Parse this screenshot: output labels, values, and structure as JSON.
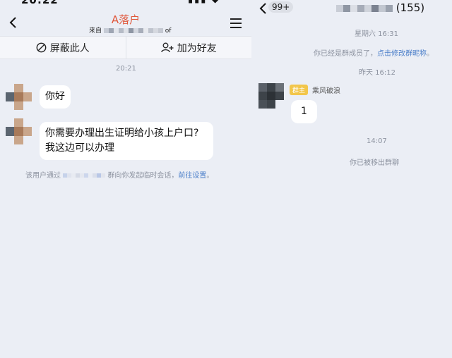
{
  "left_chat": {
    "title": "A落户",
    "subtitle_prefix": "来自",
    "subtitle_suffix": "of",
    "actions": {
      "block_label": "屏蔽此人",
      "add_friend_label": "加为好友"
    },
    "timestamp": "20:21",
    "messages": [
      {
        "text": "你好"
      },
      {
        "line1": "你需要办理出生证明给小孩上户口?",
        "line2": "我这边可以办理"
      }
    ],
    "notice": {
      "prefix": "该用户通过",
      "middle": "群向你发起临时会话，",
      "link": "前往设置",
      "suffix": "。"
    }
  },
  "right_chat": {
    "unread_badge": "99+",
    "member_count": "(155)",
    "timestamp_1": "星期六 16:31",
    "system_1": {
      "text": "你已经是群成员了，",
      "link": "点击修改群昵称",
      "suffix": "。"
    },
    "timestamp_2": "昨天 16:12",
    "owner_tag": "群主",
    "sender_name": "乘风破浪",
    "message": "1",
    "timestamp_3": "14:07",
    "system_2": "你已被移出群聊"
  },
  "colors": {
    "title_accent": "#e0573b",
    "link": "#4a7ec9",
    "owner_tag": "#f2c64a",
    "background": "#ebeef5"
  },
  "icons": [
    "chevron-left-icon",
    "menu-icon",
    "block-icon",
    "add-friend-icon"
  ]
}
